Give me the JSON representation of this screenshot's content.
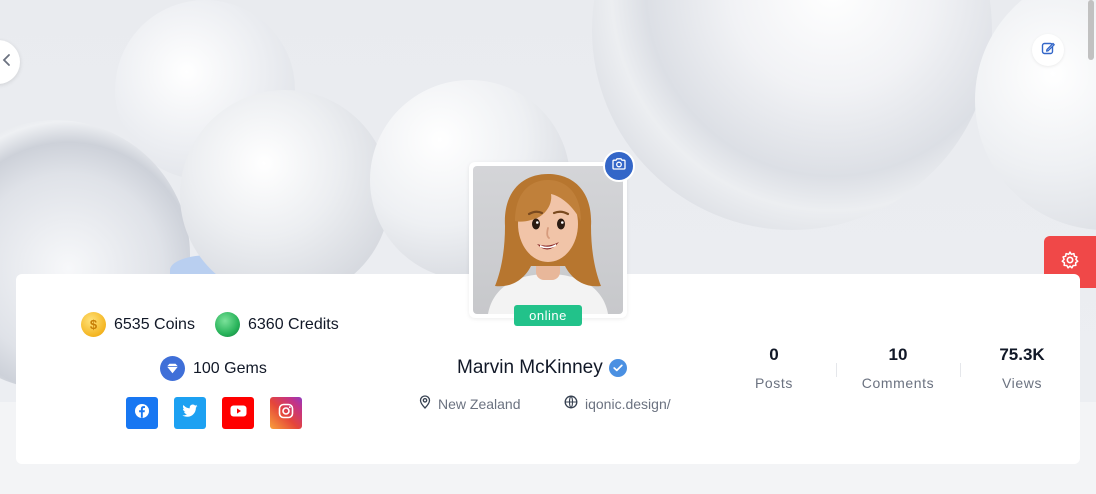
{
  "profile": {
    "name": "Marvin McKinney",
    "status": "online",
    "location": "New Zealand",
    "website": "iqonic.design/",
    "verified_icon": "verified-badge-icon"
  },
  "currencies": {
    "coins": "6535 Coins",
    "credits": "6360 Credits",
    "gems": "100 Gems"
  },
  "coin_symbol": "$",
  "socials": [
    {
      "name": "facebook",
      "icon": "facebook-icon",
      "color": "#1877f2"
    },
    {
      "name": "twitter",
      "icon": "twitter-icon",
      "color": "#1da1f2"
    },
    {
      "name": "youtube",
      "icon": "youtube-icon",
      "color": "#ff0000"
    },
    {
      "name": "instagram",
      "icon": "instagram-icon",
      "color": "#e5463a"
    }
  ],
  "stats": [
    {
      "value": "0",
      "label": "Posts"
    },
    {
      "value": "10",
      "label": "Comments"
    },
    {
      "value": "75.3K",
      "label": "Views"
    }
  ],
  "colors": {
    "accent": "#3366c8",
    "online": "#22c28a",
    "settings": "#f04848"
  }
}
